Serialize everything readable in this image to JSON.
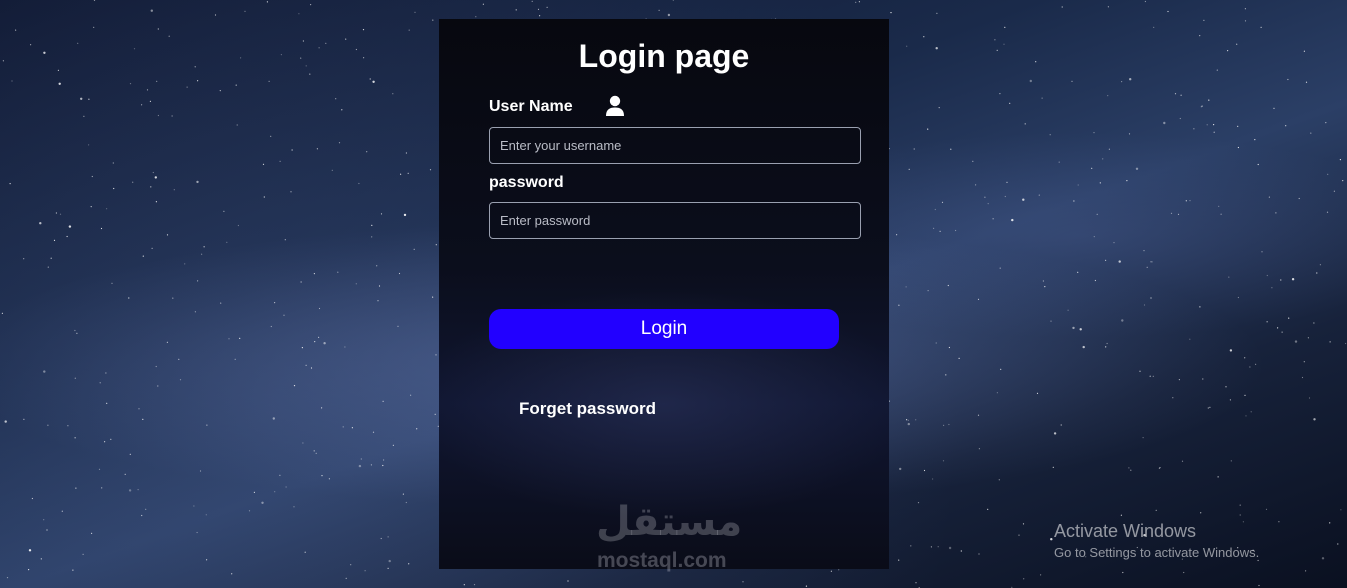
{
  "page": {
    "title": "Login page"
  },
  "form": {
    "username_label": "User Name",
    "username_placeholder": "Enter your username",
    "username_value": "",
    "password_label": "password",
    "password_placeholder": "Enter password",
    "password_value": "",
    "login_label": "Login",
    "forget_label": "Forget password"
  },
  "icons": {
    "user": "user-icon"
  },
  "watermark": {
    "arabic": "مستقل",
    "latin": "mostaql.com"
  },
  "os_overlay": {
    "line1": "Activate Windows",
    "line2": "Go to Settings to activate Windows."
  },
  "colors": {
    "accent": "#2200ff",
    "card_bg": "#0b0e1c",
    "text": "#ffffff"
  }
}
